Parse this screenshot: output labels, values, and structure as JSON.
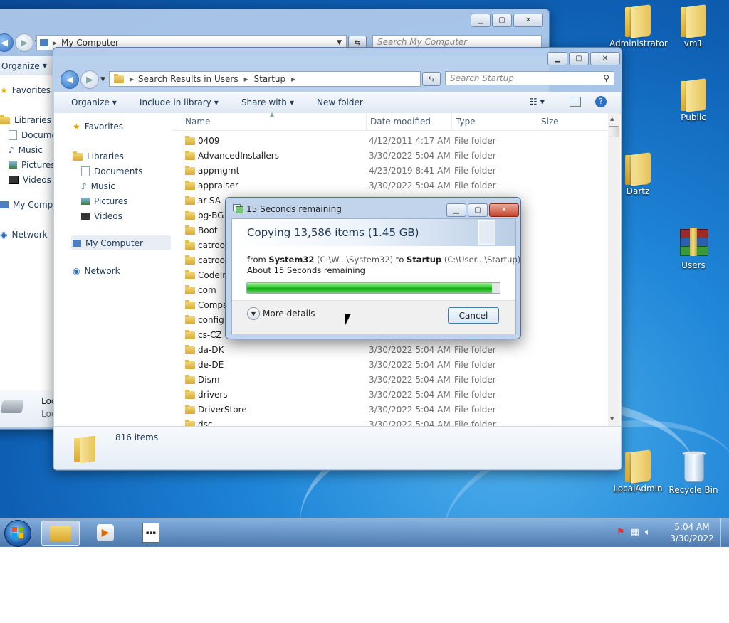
{
  "desktop": {
    "icons": [
      {
        "label": "Administrator",
        "icon": "folder-icon"
      },
      {
        "label": "vm1",
        "icon": "folder-icon"
      },
      {
        "label": "Public",
        "icon": "folder-icon"
      },
      {
        "label": "Dartz",
        "icon": "folder-icon"
      },
      {
        "label": "Users",
        "icon": "winrar-archive-icon"
      },
      {
        "label": "LocalAdmin",
        "icon": "folder-icon"
      },
      {
        "label": "Recycle Bin",
        "icon": "recycle-bin-icon"
      }
    ]
  },
  "back_window": {
    "address": "My Computer",
    "search_placeholder": "Search My Computer",
    "organize": "Organize",
    "nav": [
      "Favorites",
      "Libraries",
      "Docume",
      "Music",
      "Pictures",
      "Videos",
      "My Comp",
      "Network"
    ],
    "drive_label_1": "Loc",
    "drive_label_2": "Loc"
  },
  "front_window": {
    "breadcrumb": [
      "Search Results in Users",
      "Startup"
    ],
    "search_placeholder": "Search Startup",
    "toolbar": {
      "organize": "Organize",
      "include": "Include in library",
      "share": "Share with",
      "new_folder": "New folder"
    },
    "nav": {
      "favorites": "Favorites",
      "libraries": "Libraries",
      "documents": "Documents",
      "music": "Music",
      "pictures": "Pictures",
      "videos": "Videos",
      "my_computer": "My Computer",
      "network": "Network"
    },
    "columns": {
      "name": "Name",
      "date": "Date modified",
      "type": "Type",
      "size": "Size"
    },
    "files": [
      {
        "name": "0409",
        "date": "4/12/2011 4:17 AM",
        "type": "File folder"
      },
      {
        "name": "AdvancedInstallers",
        "date": "3/30/2022 5:04 AM",
        "type": "File folder"
      },
      {
        "name": "appmgmt",
        "date": "4/23/2019 8:41 AM",
        "type": "File folder"
      },
      {
        "name": "appraiser",
        "date": "3/30/2022 5:04 AM",
        "type": "File folder"
      },
      {
        "name": "ar-SA",
        "date": "",
        "type": ""
      },
      {
        "name": "bg-BG",
        "date": "",
        "type": ""
      },
      {
        "name": "Boot",
        "date": "",
        "type": ""
      },
      {
        "name": "catroot",
        "date": "",
        "type": ""
      },
      {
        "name": "catroot",
        "date": "",
        "type": ""
      },
      {
        "name": "CodeIn",
        "date": "",
        "type": ""
      },
      {
        "name": "com",
        "date": "",
        "type": ""
      },
      {
        "name": "Compa",
        "date": "",
        "type": ""
      },
      {
        "name": "config",
        "date": "",
        "type": ""
      },
      {
        "name": "cs-CZ",
        "date": "3/30/2022 5:04 AM",
        "type": "File folder"
      },
      {
        "name": "da-DK",
        "date": "3/30/2022 5:04 AM",
        "type": "File folder"
      },
      {
        "name": "de-DE",
        "date": "3/30/2022 5:04 AM",
        "type": "File folder"
      },
      {
        "name": "Dism",
        "date": "3/30/2022 5:04 AM",
        "type": "File folder"
      },
      {
        "name": "drivers",
        "date": "3/30/2022 5:04 AM",
        "type": "File folder"
      },
      {
        "name": "DriverStore",
        "date": "3/30/2022 5:04 AM",
        "type": "File folder"
      },
      {
        "name": "dsc",
        "date": "3/30/2022 5:04 AM",
        "type": "File folder"
      }
    ],
    "status": "816 items"
  },
  "dialog": {
    "title": "15 Seconds remaining",
    "heading": "Copying 13,586 items (1.45 GB)",
    "from_word": "from",
    "source_name": "System32",
    "source_path": "(C:\\W...\\System32)",
    "to_word": "to",
    "dest_name": "Startup",
    "dest_path": "(C:\\User...\\Startup)",
    "remaining": "About 15 Seconds remaining",
    "progress": 0.97,
    "more_details": "More details",
    "cancel": "Cancel"
  },
  "taskbar": {
    "time": "5:04 AM",
    "date": "3/30/2022"
  },
  "colors": {
    "progress_green": "#13a612",
    "close_red": "#c7432b",
    "desktop_blue": "#1f86d8"
  }
}
